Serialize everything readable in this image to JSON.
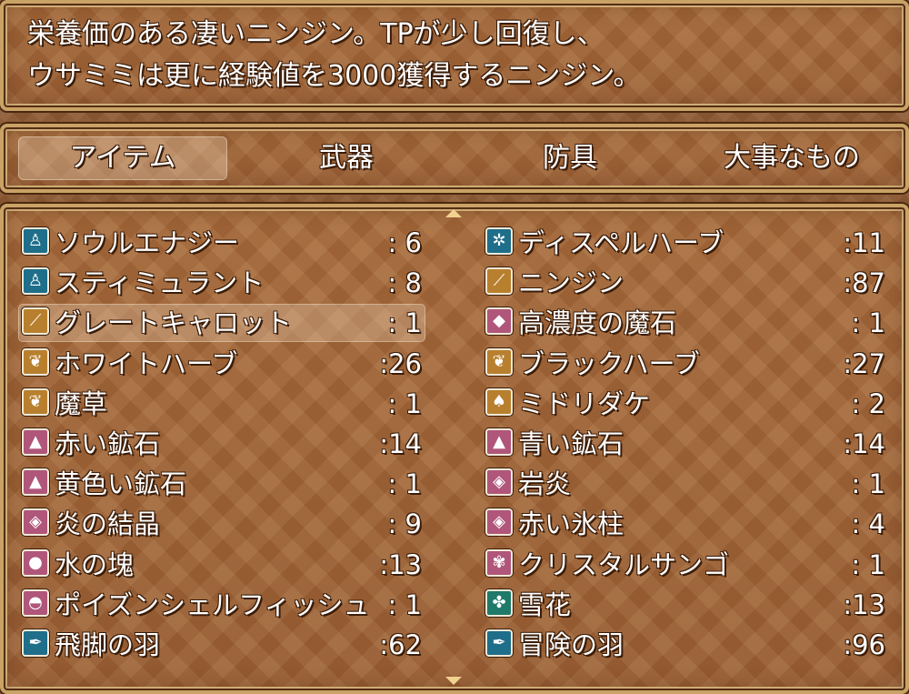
{
  "help": {
    "line1": "栄養価のある凄いニンジン。TPが少し回復し、",
    "line2": "ウサミミは更に経験値を3000獲得するニンジン。"
  },
  "tabs": [
    {
      "label": "アイテム",
      "selected": true
    },
    {
      "label": "武器",
      "selected": false
    },
    {
      "label": "防具",
      "selected": false
    },
    {
      "label": "大事なもの",
      "selected": false
    }
  ],
  "items": [
    {
      "name": "ソウルエナジー",
      "count": ":  6",
      "icon": "person-icon",
      "glyph": "♙",
      "color": "#1f6e8a",
      "selected": false
    },
    {
      "name": "ディスペルハーブ",
      "count": ":11",
      "icon": "palm-icon",
      "glyph": "✲",
      "color": "#1f6e8a",
      "selected": false
    },
    {
      "name": "スティミュラント",
      "count": ":  8",
      "icon": "person-icon",
      "glyph": "♙",
      "color": "#1f6e8a",
      "selected": false
    },
    {
      "name": "ニンジン",
      "count": ":87",
      "icon": "carrot-icon",
      "glyph": "⟋",
      "color": "#b8802e",
      "selected": false
    },
    {
      "name": "グレートキャロット",
      "count": ":  1",
      "icon": "carrot-icon",
      "glyph": "⟋",
      "color": "#b8802e",
      "selected": true
    },
    {
      "name": "高濃度の魔石",
      "count": ":  1",
      "icon": "crystal-icon",
      "glyph": "◆",
      "color": "#b0567a",
      "selected": false
    },
    {
      "name": "ホワイトハーブ",
      "count": ":26",
      "icon": "herb-icon",
      "glyph": "❦",
      "color": "#b8802e",
      "selected": false
    },
    {
      "name": "ブラックハーブ",
      "count": ":27",
      "icon": "herb-icon",
      "glyph": "❦",
      "color": "#b8802e",
      "selected": false
    },
    {
      "name": "魔草",
      "count": ":  1",
      "icon": "herb-icon",
      "glyph": "❦",
      "color": "#b8802e",
      "selected": false
    },
    {
      "name": "ミドリダケ",
      "count": ":  2",
      "icon": "mushroom-icon",
      "glyph": "♠",
      "color": "#b8802e",
      "selected": false
    },
    {
      "name": "赤い鉱石",
      "count": ":14",
      "icon": "ore-icon",
      "glyph": "▲",
      "color": "#b0567a",
      "selected": false
    },
    {
      "name": "青い鉱石",
      "count": ":14",
      "icon": "ore-icon",
      "glyph": "▲",
      "color": "#b0567a",
      "selected": false
    },
    {
      "name": "黄色い鉱石",
      "count": ":  1",
      "icon": "ore-icon",
      "glyph": "▲",
      "color": "#b0567a",
      "selected": false
    },
    {
      "name": "岩炎",
      "count": ":  1",
      "icon": "rock-icon",
      "glyph": "◈",
      "color": "#b0567a",
      "selected": false
    },
    {
      "name": "炎の結晶",
      "count": ":  9",
      "icon": "rock-icon",
      "glyph": "◈",
      "color": "#b0567a",
      "selected": false
    },
    {
      "name": "赤い氷柱",
      "count": ":  4",
      "icon": "rock-icon",
      "glyph": "◈",
      "color": "#b0567a",
      "selected": false
    },
    {
      "name": "水の塊",
      "count": ":13",
      "icon": "orb-icon",
      "glyph": "●",
      "color": "#b0567a",
      "selected": false
    },
    {
      "name": "クリスタルサンゴ",
      "count": ":  1",
      "icon": "coral-icon",
      "glyph": "✾",
      "color": "#b0567a",
      "selected": false
    },
    {
      "name": "ポイズンシェルフィッシュ",
      "count": ":  1",
      "icon": "shell-icon",
      "glyph": "◓",
      "color": "#b0567a",
      "selected": false
    },
    {
      "name": "雪花",
      "count": ":13",
      "icon": "clover-icon",
      "glyph": "✤",
      "color": "#1f7a6a",
      "selected": false
    },
    {
      "name": "飛脚の羽",
      "count": ":62",
      "icon": "feather-icon",
      "glyph": "✒",
      "color": "#1f6e8a",
      "selected": false
    },
    {
      "name": "冒険の羽",
      "count": ":96",
      "icon": "feather-icon",
      "glyph": "✒",
      "color": "#1f6e8a",
      "selected": false
    }
  ]
}
